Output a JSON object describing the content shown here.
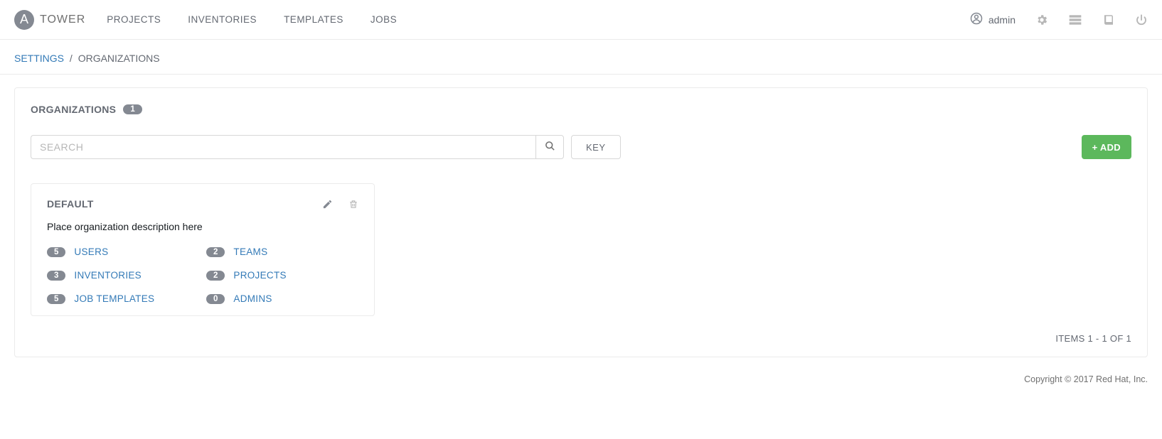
{
  "brand": {
    "logo_letter": "A",
    "name": "TOWER"
  },
  "nav": {
    "items": [
      "PROJECTS",
      "INVENTORIES",
      "TEMPLATES",
      "JOBS"
    ]
  },
  "user": {
    "name": "admin"
  },
  "breadcrumb": {
    "link": "SETTINGS",
    "sep": "/",
    "current": "ORGANIZATIONS"
  },
  "panel": {
    "title": "ORGANIZATIONS",
    "count": "1"
  },
  "search": {
    "placeholder": "SEARCH",
    "value": ""
  },
  "buttons": {
    "key": "KEY",
    "add": "+ ADD"
  },
  "org": {
    "name": "DEFAULT",
    "description": "Place organization description here",
    "stats": {
      "users": {
        "count": "5",
        "label": "USERS"
      },
      "teams": {
        "count": "2",
        "label": "TEAMS"
      },
      "inventories": {
        "count": "3",
        "label": "INVENTORIES"
      },
      "projects": {
        "count": "2",
        "label": "PROJECTS"
      },
      "jobtemplates": {
        "count": "5",
        "label": "JOB TEMPLATES"
      },
      "admins": {
        "count": "0",
        "label": "ADMINS"
      }
    }
  },
  "pagination": "ITEMS  1 - 1 OF 1",
  "footer": "Copyright © 2017 Red Hat, Inc."
}
